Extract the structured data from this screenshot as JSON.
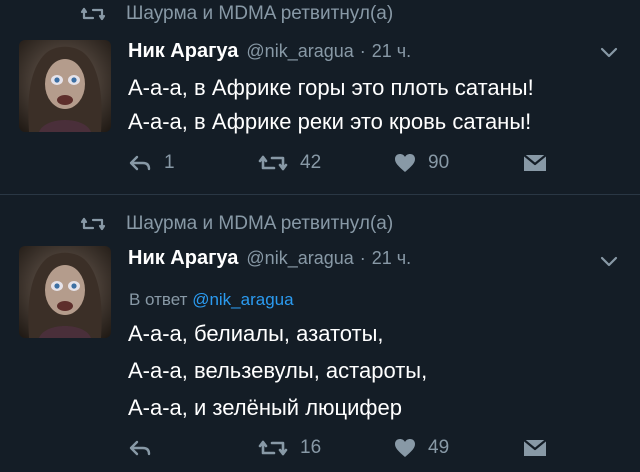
{
  "tweets": [
    {
      "retweet_by": "Шаурма и MDMA ретвитнул(а)",
      "name": "Ник Арагуа",
      "handle": "@nik_aragua",
      "dot": "·",
      "time": "21 ч.",
      "reply_prefix": "",
      "reply_handle": "",
      "lines": [
        "А-а-а, в Африке горы это плоть сатаны!",
        "А-а-а, в Африке реки это кровь сатаны!"
      ],
      "reply_count": "1",
      "retweet_count": "42",
      "like_count": "90"
    },
    {
      "retweet_by": "Шаурма и MDMA ретвитнул(а)",
      "name": "Ник Арагуа",
      "handle": "@nik_aragua",
      "dot": "·",
      "time": "21 ч.",
      "reply_prefix": "В ответ",
      "reply_handle": "@nik_aragua",
      "lines": [
        "А-а-а, белиалы, азатоты,",
        "А-а-а, вельзевулы, астароты,",
        "А-а-а, и зелёный люцифер"
      ],
      "reply_count": "",
      "retweet_count": "16",
      "like_count": "49"
    }
  ],
  "icons": {
    "retweet": "retweet-icon",
    "reply": "reply-icon",
    "like": "heart-icon",
    "dm": "envelope-icon",
    "menu": "chevron-down-icon"
  },
  "colors": {
    "background": "#141d26",
    "muted": "#8899a6",
    "link": "#2b9bf0",
    "divider": "#2a3744"
  }
}
